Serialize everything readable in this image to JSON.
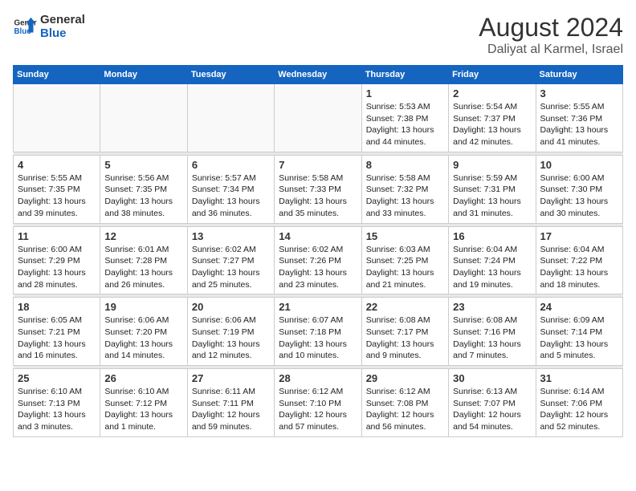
{
  "header": {
    "logo_line1": "General",
    "logo_line2": "Blue",
    "month_year": "August 2024",
    "location": "Daliyat al Karmel, Israel"
  },
  "days_of_week": [
    "Sunday",
    "Monday",
    "Tuesday",
    "Wednesday",
    "Thursday",
    "Friday",
    "Saturday"
  ],
  "weeks": [
    {
      "cells": [
        {
          "day": "",
          "content": ""
        },
        {
          "day": "",
          "content": ""
        },
        {
          "day": "",
          "content": ""
        },
        {
          "day": "",
          "content": ""
        },
        {
          "day": "1",
          "content": "Sunrise: 5:53 AM\nSunset: 7:38 PM\nDaylight: 13 hours\nand 44 minutes."
        },
        {
          "day": "2",
          "content": "Sunrise: 5:54 AM\nSunset: 7:37 PM\nDaylight: 13 hours\nand 42 minutes."
        },
        {
          "day": "3",
          "content": "Sunrise: 5:55 AM\nSunset: 7:36 PM\nDaylight: 13 hours\nand 41 minutes."
        }
      ]
    },
    {
      "cells": [
        {
          "day": "4",
          "content": "Sunrise: 5:55 AM\nSunset: 7:35 PM\nDaylight: 13 hours\nand 39 minutes."
        },
        {
          "day": "5",
          "content": "Sunrise: 5:56 AM\nSunset: 7:35 PM\nDaylight: 13 hours\nand 38 minutes."
        },
        {
          "day": "6",
          "content": "Sunrise: 5:57 AM\nSunset: 7:34 PM\nDaylight: 13 hours\nand 36 minutes."
        },
        {
          "day": "7",
          "content": "Sunrise: 5:58 AM\nSunset: 7:33 PM\nDaylight: 13 hours\nand 35 minutes."
        },
        {
          "day": "8",
          "content": "Sunrise: 5:58 AM\nSunset: 7:32 PM\nDaylight: 13 hours\nand 33 minutes."
        },
        {
          "day": "9",
          "content": "Sunrise: 5:59 AM\nSunset: 7:31 PM\nDaylight: 13 hours\nand 31 minutes."
        },
        {
          "day": "10",
          "content": "Sunrise: 6:00 AM\nSunset: 7:30 PM\nDaylight: 13 hours\nand 30 minutes."
        }
      ]
    },
    {
      "cells": [
        {
          "day": "11",
          "content": "Sunrise: 6:00 AM\nSunset: 7:29 PM\nDaylight: 13 hours\nand 28 minutes."
        },
        {
          "day": "12",
          "content": "Sunrise: 6:01 AM\nSunset: 7:28 PM\nDaylight: 13 hours\nand 26 minutes."
        },
        {
          "day": "13",
          "content": "Sunrise: 6:02 AM\nSunset: 7:27 PM\nDaylight: 13 hours\nand 25 minutes."
        },
        {
          "day": "14",
          "content": "Sunrise: 6:02 AM\nSunset: 7:26 PM\nDaylight: 13 hours\nand 23 minutes."
        },
        {
          "day": "15",
          "content": "Sunrise: 6:03 AM\nSunset: 7:25 PM\nDaylight: 13 hours\nand 21 minutes."
        },
        {
          "day": "16",
          "content": "Sunrise: 6:04 AM\nSunset: 7:24 PM\nDaylight: 13 hours\nand 19 minutes."
        },
        {
          "day": "17",
          "content": "Sunrise: 6:04 AM\nSunset: 7:22 PM\nDaylight: 13 hours\nand 18 minutes."
        }
      ]
    },
    {
      "cells": [
        {
          "day": "18",
          "content": "Sunrise: 6:05 AM\nSunset: 7:21 PM\nDaylight: 13 hours\nand 16 minutes."
        },
        {
          "day": "19",
          "content": "Sunrise: 6:06 AM\nSunset: 7:20 PM\nDaylight: 13 hours\nand 14 minutes."
        },
        {
          "day": "20",
          "content": "Sunrise: 6:06 AM\nSunset: 7:19 PM\nDaylight: 13 hours\nand 12 minutes."
        },
        {
          "day": "21",
          "content": "Sunrise: 6:07 AM\nSunset: 7:18 PM\nDaylight: 13 hours\nand 10 minutes."
        },
        {
          "day": "22",
          "content": "Sunrise: 6:08 AM\nSunset: 7:17 PM\nDaylight: 13 hours\nand 9 minutes."
        },
        {
          "day": "23",
          "content": "Sunrise: 6:08 AM\nSunset: 7:16 PM\nDaylight: 13 hours\nand 7 minutes."
        },
        {
          "day": "24",
          "content": "Sunrise: 6:09 AM\nSunset: 7:14 PM\nDaylight: 13 hours\nand 5 minutes."
        }
      ]
    },
    {
      "cells": [
        {
          "day": "25",
          "content": "Sunrise: 6:10 AM\nSunset: 7:13 PM\nDaylight: 13 hours\nand 3 minutes."
        },
        {
          "day": "26",
          "content": "Sunrise: 6:10 AM\nSunset: 7:12 PM\nDaylight: 13 hours\nand 1 minute."
        },
        {
          "day": "27",
          "content": "Sunrise: 6:11 AM\nSunset: 7:11 PM\nDaylight: 12 hours\nand 59 minutes."
        },
        {
          "day": "28",
          "content": "Sunrise: 6:12 AM\nSunset: 7:10 PM\nDaylight: 12 hours\nand 57 minutes."
        },
        {
          "day": "29",
          "content": "Sunrise: 6:12 AM\nSunset: 7:08 PM\nDaylight: 12 hours\nand 56 minutes."
        },
        {
          "day": "30",
          "content": "Sunrise: 6:13 AM\nSunset: 7:07 PM\nDaylight: 12 hours\nand 54 minutes."
        },
        {
          "day": "31",
          "content": "Sunrise: 6:14 AM\nSunset: 7:06 PM\nDaylight: 12 hours\nand 52 minutes."
        }
      ]
    }
  ]
}
